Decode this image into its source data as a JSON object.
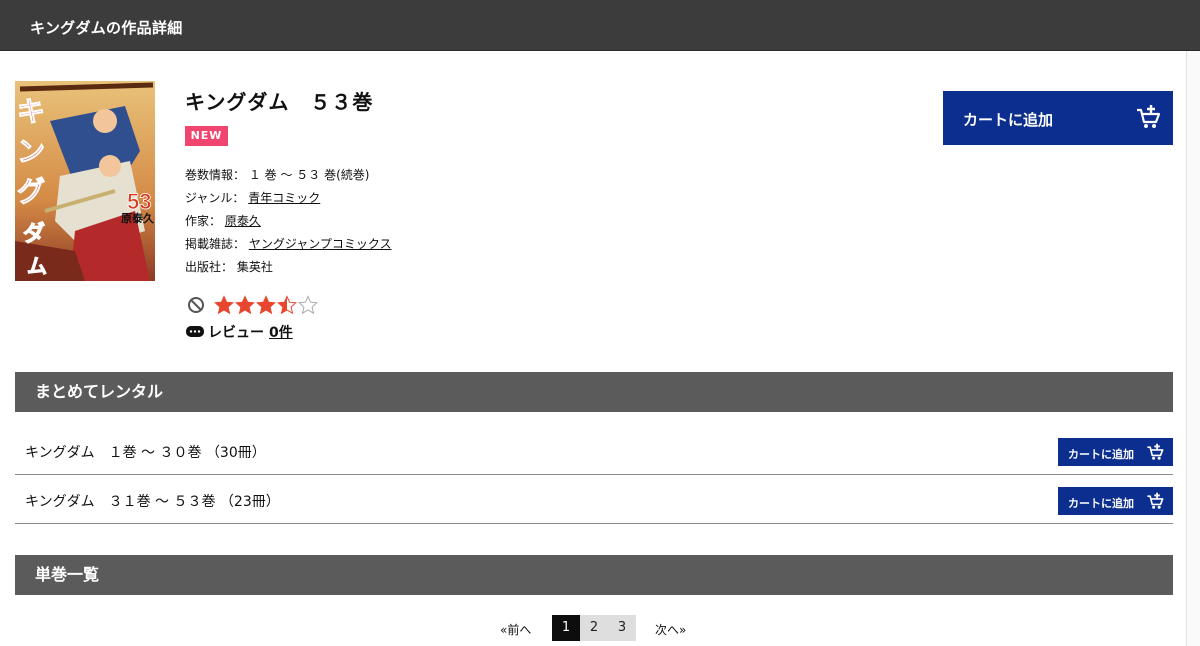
{
  "header": {
    "title": "キングダムの作品詳細"
  },
  "work": {
    "title": "キングダム　５３巻",
    "badge": "NEW",
    "volumes_label": "巻数情報：",
    "volumes_value": "１ 巻 ～ ５３ 巻(続巻)",
    "genre_label": "ジャンル：",
    "genre_value": "青年コミック",
    "author_label": "作家：",
    "author_value": "原泰久",
    "magazine_label": "掲載雑誌：",
    "magazine_value": "ヤングジャンプコミックス",
    "publisher_label": "出版社：",
    "publisher_value": "集英社",
    "rating": 3.5,
    "rating_max": 5,
    "review_label": "レビュー",
    "review_count": "0件",
    "cover": {
      "title_text": "キングダム",
      "volume": "53",
      "author": "原泰久"
    }
  },
  "cart_button": {
    "label": "カートに追加"
  },
  "bundle": {
    "heading": "まとめてレンタル",
    "rows": [
      {
        "label": "キングダム　１巻 ～ ３０巻 （30冊）",
        "button": "カートに追加"
      },
      {
        "label": "キングダム　３１巻 ～ ５３巻 （23冊）",
        "button": "カートに追加"
      }
    ]
  },
  "volumes": {
    "heading": "単巻一覧"
  },
  "pagination": {
    "prev": "«前へ",
    "next": "次へ»",
    "pages": [
      "1",
      "2",
      "3"
    ],
    "current": "1"
  },
  "colors": {
    "header_bg": "#3c3c3c",
    "section_bg": "#5b5b5b",
    "cart_blue": "#0b2e8f",
    "badge_pink": "#f0456e",
    "star_red": "#e8462e"
  }
}
